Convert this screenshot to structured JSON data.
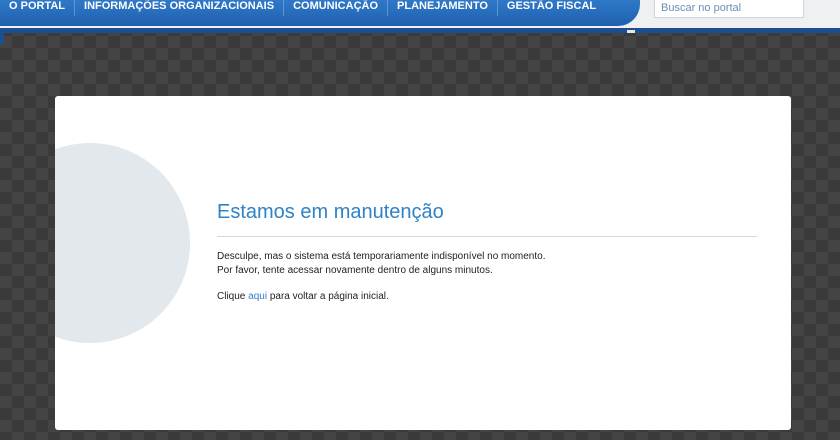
{
  "nav": {
    "items": [
      {
        "label": "O PORTAL"
      },
      {
        "label": "INFORMAÇÕES ORGANIZACIONAIS"
      },
      {
        "label": "COMUNICAÇÃO"
      },
      {
        "label": "PLANEJAMENTO"
      },
      {
        "label": "GESTÃO FISCAL"
      }
    ]
  },
  "search": {
    "placeholder": "Buscar no portal",
    "value": ""
  },
  "maintenance": {
    "icon": "exclamation-icon",
    "title": "Estamos em manutenção",
    "line1": "Desculpe, mas o sistema está temporariamente indisponível no momento.",
    "line2": "Por favor, tente acessar novamente dentro de alguns minutos.",
    "back_prefix": "Clique",
    "back_link": "aqui",
    "back_suffix": "para voltar a página inicial."
  },
  "colors": {
    "nav_blue": "#2f79c9",
    "accent": "#2f82c8",
    "icon_gray": "#e3e8ec"
  }
}
